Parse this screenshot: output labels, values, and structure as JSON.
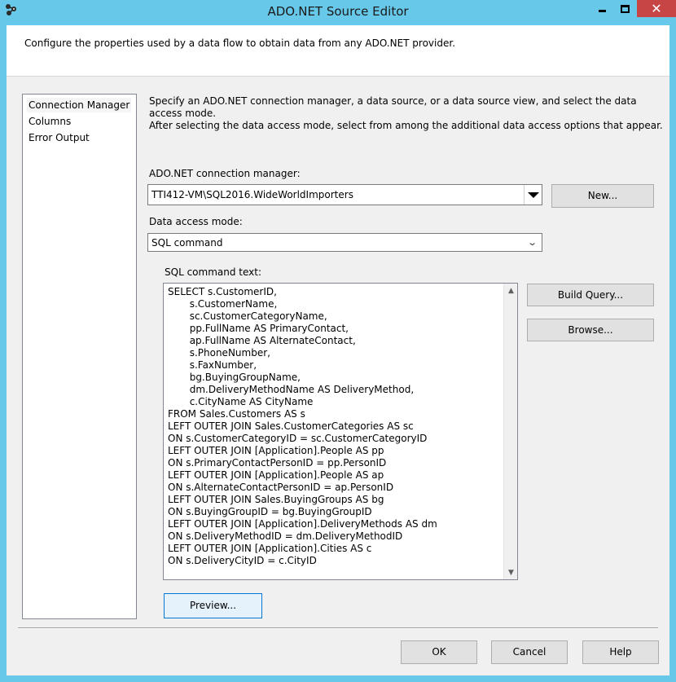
{
  "window": {
    "title": "ADO.NET Source Editor",
    "close_glyph": "✕",
    "icon": "ssis-app-icon"
  },
  "header": {
    "description": "Configure the properties used by a data flow to obtain data from any ADO.NET provider."
  },
  "nav": {
    "items": [
      {
        "label": "Connection Manager",
        "selected": true
      },
      {
        "label": "Columns",
        "selected": false
      },
      {
        "label": "Error Output",
        "selected": false
      }
    ]
  },
  "main": {
    "instructions_line1": "Specify an ADO.NET connection manager, a data source, or a data source view, and select the data access mode.",
    "instructions_line2": "After selecting the data access mode, select from among the additional data access options that appear.",
    "connection_manager_label": "ADO.NET connection manager:",
    "connection_manager_value": "TTI412-VM\\SQL2016.WideWorldImporters",
    "new_button": "New...",
    "access_mode_label": "Data access mode:",
    "access_mode_value": "SQL command",
    "sql_label": "SQL command text:",
    "sql_text": "SELECT s.CustomerID,\n       s.CustomerName,\n       sc.CustomerCategoryName,\n       pp.FullName AS PrimaryContact,\n       ap.FullName AS AlternateContact,\n       s.PhoneNumber,\n       s.FaxNumber,\n       bg.BuyingGroupName,\n       dm.DeliveryMethodName AS DeliveryMethod,\n       c.CityName AS CityName\nFROM Sales.Customers AS s\nLEFT OUTER JOIN Sales.CustomerCategories AS sc\nON s.CustomerCategoryID = sc.CustomerCategoryID\nLEFT OUTER JOIN [Application].People AS pp\nON s.PrimaryContactPersonID = pp.PersonID\nLEFT OUTER JOIN [Application].People AS ap\nON s.AlternateContactPersonID = ap.PersonID\nLEFT OUTER JOIN Sales.BuyingGroups AS bg\nON s.BuyingGroupID = bg.BuyingGroupID\nLEFT OUTER JOIN [Application].DeliveryMethods AS dm\nON s.DeliveryMethodID = dm.DeliveryMethodID\nLEFT OUTER JOIN [Application].Cities AS c\nON s.DeliveryCityID = c.CityID",
    "build_query_button": "Build Query...",
    "browse_button": "Browse...",
    "preview_button": "Preview..."
  },
  "footer": {
    "ok_button": "OK",
    "cancel_button": "Cancel",
    "help_button": "Help"
  },
  "colors": {
    "titlebar": "#67c8ea",
    "close_button": "#c74545",
    "dialog_background": "#f0f0f0",
    "focus_border": "#0078d7"
  }
}
